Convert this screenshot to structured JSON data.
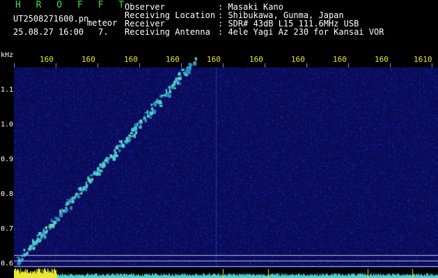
{
  "header": {
    "app_title": "H R O F F T",
    "filename": "UT2508271600.pn",
    "filename_suffix": "meteor",
    "timestamp": "25.08.27 16:00",
    "count": "7.",
    "info": [
      {
        "key": "Observer",
        "value": ": Masaki Kano"
      },
      {
        "key": "Receiving Location",
        "value": ": Shibukawa, Gunma, Japan"
      },
      {
        "key": "Receiver",
        "value": ": SDR# 43dB L15 111.6MHz USB"
      },
      {
        "key": "Receiving Antenna",
        "value": ": 4ele Yagi Az 230 for Kansai VOR"
      }
    ]
  },
  "axis": {
    "unit": "kHz",
    "y_labels": [
      "1.1",
      "1.0",
      "0.9",
      "0.8",
      "0.7",
      "0.6"
    ],
    "x_labels": [
      "160",
      "160",
      "160",
      "160",
      "160",
      "160",
      "160",
      "160",
      "160",
      "160",
      "1610"
    ]
  },
  "colors": {
    "background": "#0a0a55",
    "trace": "#4fd0d0",
    "signal": "#e8e830",
    "title": "#39e639"
  }
}
